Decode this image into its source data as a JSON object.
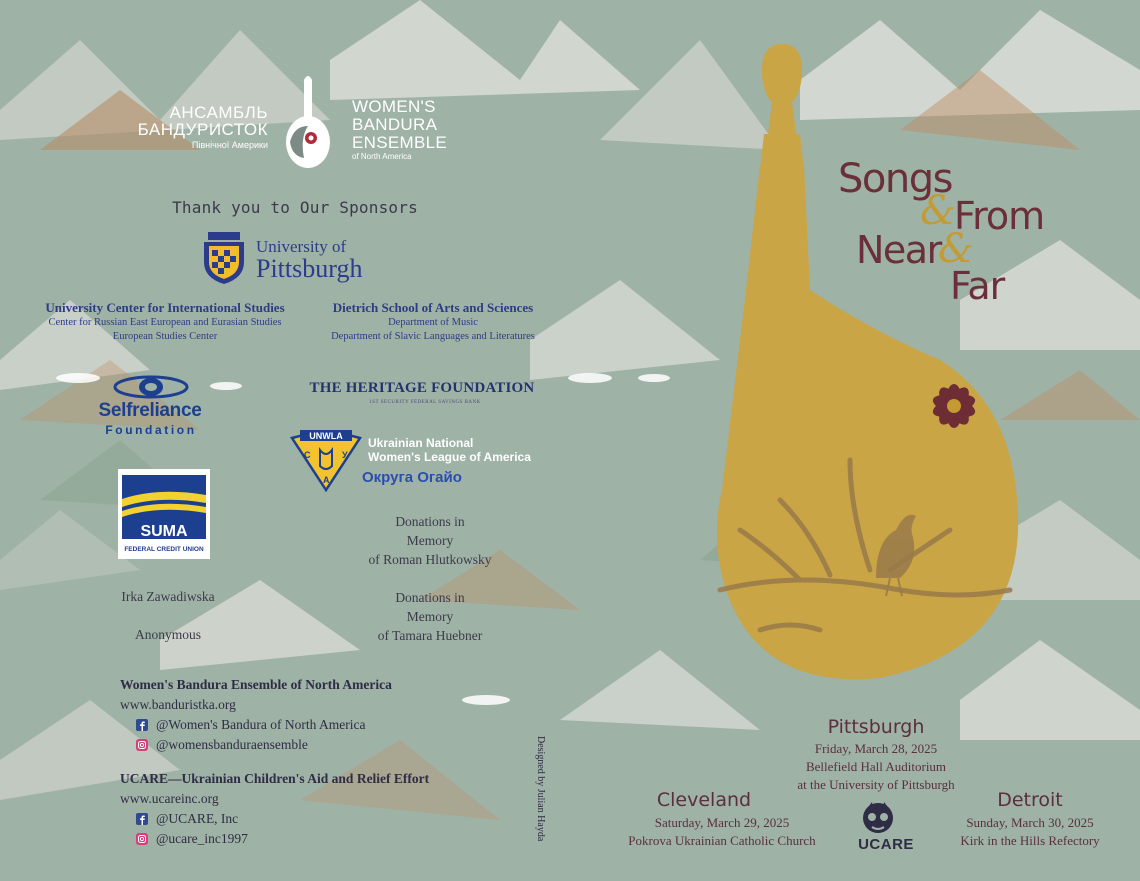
{
  "colors": {
    "background": "#9fb2a6",
    "mountain_light": "#e9ecea",
    "mountain_orange": "#c4885a",
    "mountain_green": "#7f9a86",
    "bandura_gold": "#c9a545",
    "title_maroon": "#6a2f3a",
    "ampersand_gold": "#c49a32",
    "flower": "#6e2c35",
    "pitt_blue": "#2b3c8c",
    "pitt_gold": "#f2bd2a"
  },
  "ensemble": {
    "ukr_line1": "АНСАМБЛЬ",
    "ukr_line2": "БАНДУРИСТОК",
    "ukr_line3": "Північної Америки",
    "eng_line1": "WOMEN'S",
    "eng_line2": "BANDURA",
    "eng_line3": "ENSEMBLE",
    "eng_line4": "of North America"
  },
  "sponsors": {
    "heading": "Thank you to Our Sponsors",
    "pitt": {
      "line1": "University of",
      "line2": "Pittsburgh"
    },
    "ucis": {
      "name": "University Center for International Studies",
      "sub1": "Center for Russian East European and Eurasian Studies",
      "sub2": "European Studies Center"
    },
    "dsas": {
      "name": "Dietrich School of Arts and Sciences",
      "sub1": "Department of Music",
      "sub2": "Department of Slavic Languages and Literatures"
    },
    "selfreliance": {
      "name": "Selfreliance",
      "sub": "Foundation"
    },
    "heritage": {
      "name": "THE HERITAGE FOUNDATION",
      "sub": "1ST SECURITY FEDERAL SAVINGS BANK"
    },
    "unwla": {
      "badge": "UNWLA",
      "line1": "Ukrainian National",
      "line2": "Women's League of America",
      "region": "Округа Огайо",
      "letters": [
        "С",
        "У",
        "А"
      ]
    },
    "suma": {
      "name": "SUMA",
      "sub": "FEDERAL CREDIT UNION"
    },
    "donation1": {
      "l1": "Donations in",
      "l2": "Memory",
      "l3": "of Roman Hlutkowsky"
    },
    "donation2": {
      "l1": "Donations in",
      "l2": "Memory",
      "l3": "of Tamara Huebner"
    },
    "irka": "Irka Zawadiwska",
    "anonymous": "Anonymous"
  },
  "contacts": {
    "wbe": {
      "heading": "Women's Bandura Ensemble of North America",
      "url": "www.banduristka.org",
      "facebook": "@Women's Bandura of North America",
      "instagram": "@womensbanduraensemble"
    },
    "ucare": {
      "heading": "UCARE—Ukrainian Children's Aid and Relief Effort",
      "url": "www.ucareinc.org",
      "facebook": "@UCARE, Inc",
      "instagram": "@ucare_inc1997"
    }
  },
  "designer": "Designed by Julian Hayda",
  "title": {
    "songs": "Songs",
    "from": "From",
    "near": "Near",
    "far": "Far",
    "amp": "&"
  },
  "concerts": {
    "pittsburgh": {
      "city": "Pittsburgh",
      "date": "Friday, March 28, 2025",
      "venue1": "Bellefield Hall Auditorium",
      "venue2": "at the University of Pittsburgh"
    },
    "cleveland": {
      "city": "Cleveland",
      "date": "Saturday, March 29, 2025",
      "venue": "Pokrova Ukrainian Catholic Church"
    },
    "detroit": {
      "city": "Detroit",
      "date": "Sunday, March 30, 2025",
      "venue": "Kirk in the Hills Refectory"
    },
    "ucare_logo": "UCARE"
  }
}
